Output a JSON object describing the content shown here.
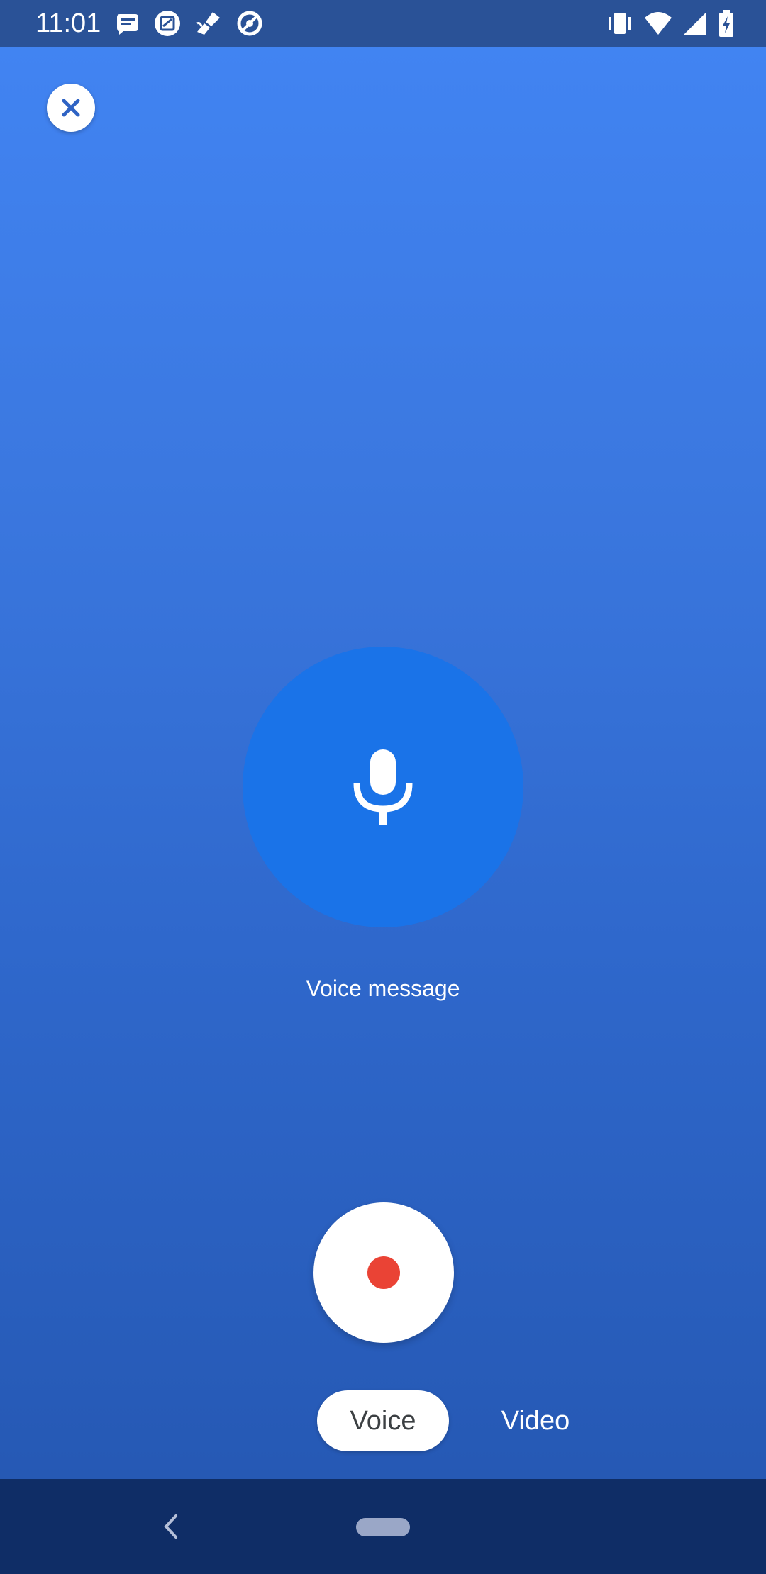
{
  "status_bar": {
    "time": "11:01",
    "left_icons": [
      "message-notification-icon",
      "screenshot-icon",
      "broom-icon",
      "circle-slash-icon"
    ],
    "right_icons": [
      "vibrate-icon",
      "wifi-icon",
      "cell-signal-icon",
      "battery-charging-icon"
    ]
  },
  "close_icon": "close-icon",
  "mic_icon": "microphone-icon",
  "caption": "Voice message",
  "record": {
    "icon": "record-dot",
    "color": "#ea4335"
  },
  "tabs": [
    {
      "label": "Voice",
      "selected": true
    },
    {
      "label": "Video",
      "selected": false
    }
  ],
  "nav": {
    "back_icon": "back-chevron-icon",
    "home_icon": "home-pill-icon"
  },
  "colors": {
    "accent": "#1a73e8",
    "gradient_top": "#4285f4",
    "gradient_bottom": "#2456b0",
    "nav_bar": "#0f2d66",
    "status_bar": "#2a5297"
  }
}
